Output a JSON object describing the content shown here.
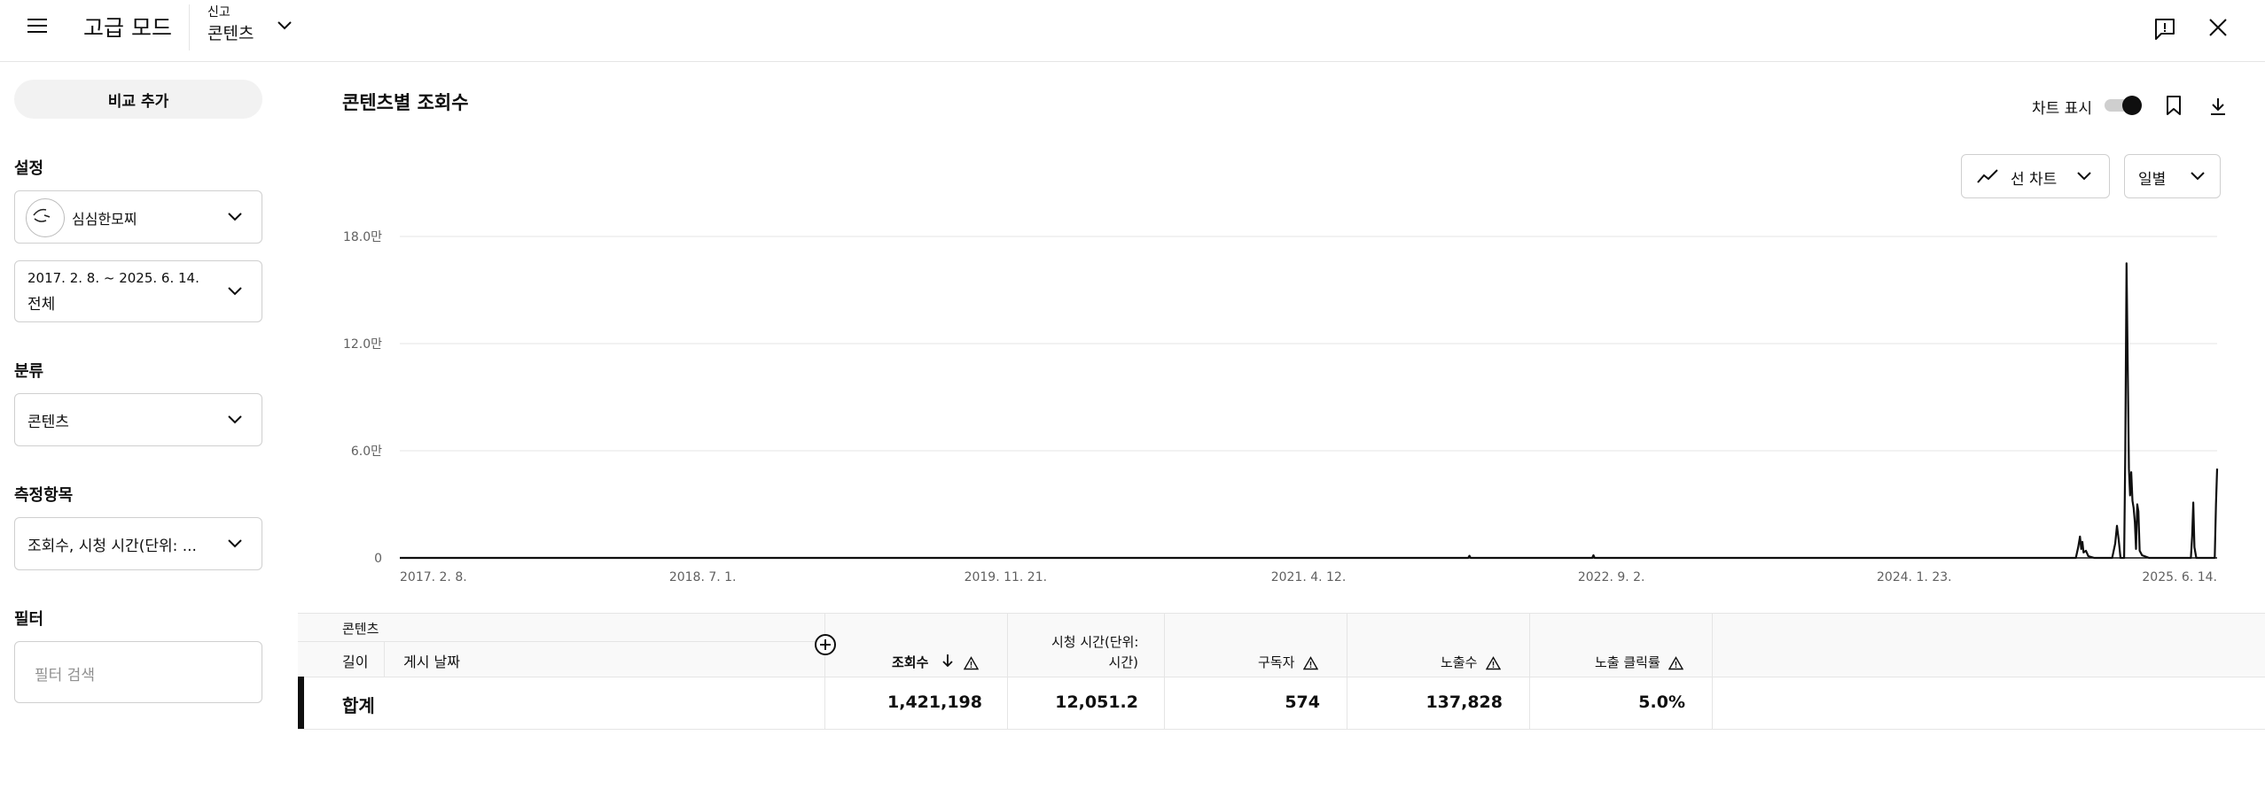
{
  "header": {
    "app_title": "고급 모드",
    "report_kind": "신고",
    "report_name": "콘텐츠"
  },
  "sidebar": {
    "compare_button": "비교 추가",
    "settings_label": "설정",
    "channel_name": "심심한모찌",
    "date_range": "2017. 2. 8. ~ 2025. 6. 14.",
    "date_preset": "전체",
    "category_label": "분류",
    "category_value": "콘텐츠",
    "metrics_label": "측정항목",
    "metrics_value": "조회수, 시청 시간(단위: ...",
    "filter_label": "필터",
    "filter_placeholder": "필터 검색"
  },
  "main": {
    "chart_title": "콘텐츠별 조회수",
    "show_chart_label": "차트 표시",
    "chart_type_label": "선 차트",
    "period_label": "일별"
  },
  "chart_data": {
    "type": "line",
    "title": "콘텐츠별 조회수",
    "xlabel": "",
    "ylabel": "",
    "ylim": [
      0,
      180000
    ],
    "yticks": [
      {
        "value": 0,
        "label": "0"
      },
      {
        "value": 60000,
        "label": "6.0만"
      },
      {
        "value": 120000,
        "label": "12.0만"
      },
      {
        "value": 180000,
        "label": "18.0만"
      }
    ],
    "xticks": [
      {
        "date": "2017-02-08",
        "label": "2017. 2. 8."
      },
      {
        "date": "2018-07-01",
        "label": "2018. 7. 1."
      },
      {
        "date": "2019-11-21",
        "label": "2019. 11. 21."
      },
      {
        "date": "2021-04-12",
        "label": "2021. 4. 12."
      },
      {
        "date": "2022-09-02",
        "label": "2022. 9. 2."
      },
      {
        "date": "2024-01-23",
        "label": "2024. 1. 23."
      },
      {
        "date": "2025-06-14",
        "label": "2025. 6. 14."
      }
    ],
    "xlim": [
      "2017-02-08",
      "2025-06-14"
    ],
    "grid": true,
    "series": [
      {
        "points": [
          [
            "2017-02-08",
            0
          ],
          [
            "2022-01-05",
            0
          ],
          [
            "2022-01-07",
            1200
          ],
          [
            "2022-01-09",
            0
          ],
          [
            "2022-08-01",
            0
          ],
          [
            "2022-08-03",
            1500
          ],
          [
            "2022-08-05",
            0
          ],
          [
            "2024-10-20",
            0
          ],
          [
            "2024-10-24",
            6000
          ],
          [
            "2024-10-27",
            12000
          ],
          [
            "2024-10-29",
            5000
          ],
          [
            "2024-10-31",
            9000
          ],
          [
            "2024-11-02",
            3000
          ],
          [
            "2024-11-06",
            4000
          ],
          [
            "2024-11-10",
            1000
          ],
          [
            "2024-11-20",
            0
          ],
          [
            "2024-12-20",
            0
          ],
          [
            "2024-12-25",
            8000
          ],
          [
            "2024-12-28",
            18000
          ],
          [
            "2024-12-31",
            10000
          ],
          [
            "2025-01-03",
            0
          ],
          [
            "2025-01-09",
            0
          ],
          [
            "2025-01-11",
            60000
          ],
          [
            "2025-01-13",
            165000
          ],
          [
            "2025-01-15",
            110000
          ],
          [
            "2025-01-17",
            50000
          ],
          [
            "2025-01-19",
            35000
          ],
          [
            "2025-01-21",
            48000
          ],
          [
            "2025-01-23",
            32000
          ],
          [
            "2025-01-25",
            28000
          ],
          [
            "2025-01-27",
            20000
          ],
          [
            "2025-01-29",
            5000
          ],
          [
            "2025-01-31",
            30000
          ],
          [
            "2025-02-02",
            26000
          ],
          [
            "2025-02-04",
            4000
          ],
          [
            "2025-02-08",
            1500
          ],
          [
            "2025-02-20",
            0
          ],
          [
            "2025-05-01",
            0
          ],
          [
            "2025-05-03",
            12000
          ],
          [
            "2025-05-05",
            31000
          ],
          [
            "2025-05-07",
            6000
          ],
          [
            "2025-05-10",
            0
          ],
          [
            "2025-06-10",
            0
          ],
          [
            "2025-06-12",
            30000
          ],
          [
            "2025-06-14",
            50000
          ]
        ]
      }
    ]
  },
  "table": {
    "group_header": "콘텐츠",
    "col_length": "길이",
    "col_published": "게시 날짜",
    "columns": [
      "조회수",
      "시청 시간(단위:",
      "시간)",
      "구독자",
      "노출수",
      "노출 클릭률"
    ],
    "total_label": "합계",
    "totals": {
      "views": "1,421,198",
      "watch_time": "12,051.2",
      "subscribers": "574",
      "impressions": "137,828",
      "ctr": "5.0%"
    }
  },
  "colors": {
    "accent": "#0f0f0f",
    "divider": "#e5e5e5",
    "button_bg": "#f2f2f2",
    "table_header_bg": "#f9f9f9"
  },
  "icons": [
    "menu-icon",
    "chevron-down-icon",
    "feedback-icon",
    "close-icon",
    "bookmark-icon",
    "download-icon",
    "line-chart-icon",
    "add-column-icon",
    "sort-down-icon",
    "warning-icon"
  ]
}
